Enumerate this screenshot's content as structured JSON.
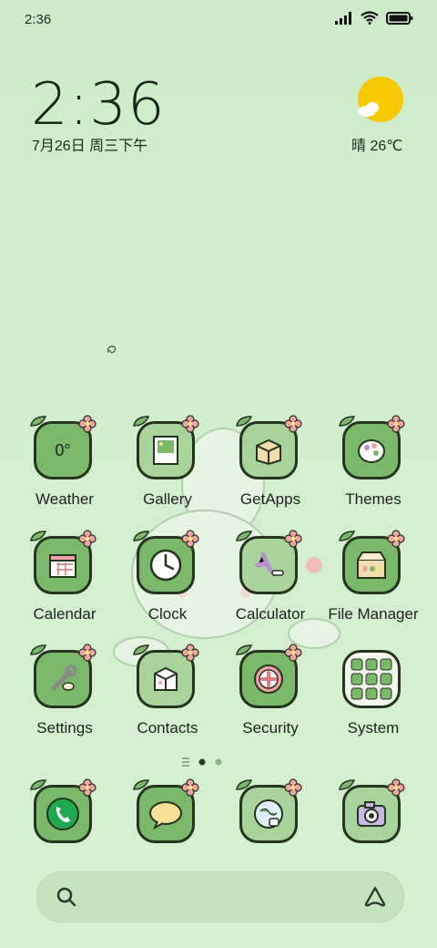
{
  "status_bar": {
    "time": "2:36"
  },
  "clock_widget": {
    "time": "2:36",
    "date": "7月26日 周三下午"
  },
  "weather_widget": {
    "text": "晴 26℃"
  },
  "apps": [
    {
      "label": "Weather",
      "icon": "weather-icon",
      "tile_text": "0°"
    },
    {
      "label": "Gallery",
      "icon": "gallery-icon"
    },
    {
      "label": "GetApps",
      "icon": "getapps-icon"
    },
    {
      "label": "Themes",
      "icon": "themes-icon"
    },
    {
      "label": "Calendar",
      "icon": "calendar-icon"
    },
    {
      "label": "Clock",
      "icon": "clock-icon"
    },
    {
      "label": "Calculator",
      "icon": "calculator-icon"
    },
    {
      "label": "File Manager",
      "icon": "file-manager-icon"
    },
    {
      "label": "Settings",
      "icon": "settings-icon"
    },
    {
      "label": "Contacts",
      "icon": "contacts-icon"
    },
    {
      "label": "Security",
      "icon": "security-icon"
    },
    {
      "label": "System",
      "icon": "system-folder-icon"
    }
  ],
  "dock": [
    {
      "icon": "phone-icon"
    },
    {
      "icon": "messages-icon"
    },
    {
      "icon": "browser-icon"
    },
    {
      "icon": "camera-icon"
    }
  ],
  "page_indicator": {
    "pages": 2,
    "current": 1
  },
  "colors": {
    "background": "#cdebc9",
    "tile": "#7ab86a",
    "outline": "#26331f",
    "flower": "#f2a1a8",
    "sun": "#f7c700"
  }
}
